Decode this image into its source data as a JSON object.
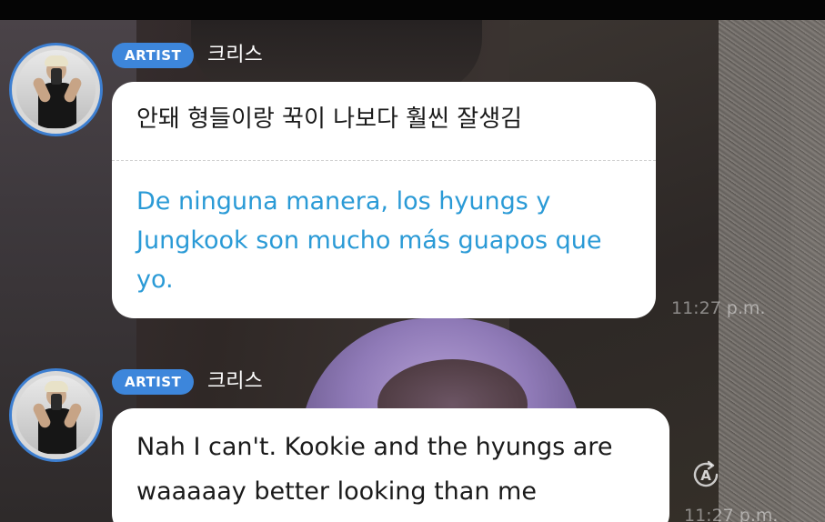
{
  "messages": [
    {
      "role_badge": "ARTIST",
      "sender": "크리스",
      "original": "안돼 형들이랑 꾹이 나보다 훨씬 잘생김",
      "translation": "De ninguna manera, los hyungs y Jungkook son mucho más guapos que yo.",
      "time": "11:27 p.m."
    },
    {
      "role_badge": "ARTIST",
      "sender": "크리스",
      "text": "Nah I can't. Kookie and the hyungs are waaaaay better looking than me",
      "time": "11:27 p.m.",
      "translate_icon": "translate-icon",
      "translate_glyph": "A"
    }
  ],
  "colors": {
    "badge": "#3d86db",
    "translation_text": "#2a9ad6",
    "avatar_ring": "#3d7fd1",
    "bubble": "#ffffff"
  }
}
